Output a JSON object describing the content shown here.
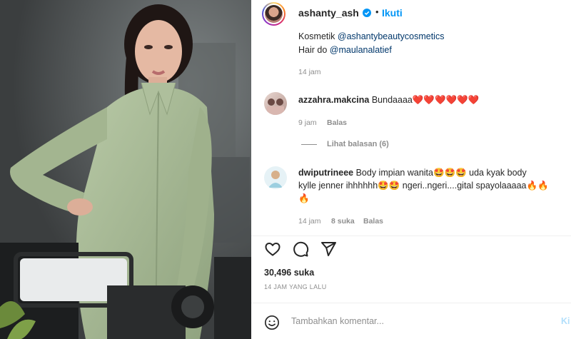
{
  "post": {
    "username": "ashanty_ash",
    "follow_label": "Ikuti",
    "separator": "•",
    "more_icon": "more-options-icon"
  },
  "caption": {
    "line1_prefix": "Kosmetik ",
    "line1_mention": "@ashantybeautycosmetics",
    "line2_prefix": "Hair do ",
    "line2_mention": "@maulanalatief",
    "time": "14 jam"
  },
  "comments": [
    {
      "username": "azzahra.makcina",
      "text": "Bundaaaa❤️❤️❤️❤️❤️❤️",
      "time": "9 jam",
      "reply_label": "Balas",
      "view_replies": "Lihat balasan (6)"
    },
    {
      "username": "dwiputrineee",
      "text_line1": "Body impian wanita🤩🤩🤩 uda kyak body",
      "text_line2": "kylle jenner ihhhhhh🤩🤩 ngeri..ngeri....gital spayolaaaaa🔥🔥",
      "text_line3": "🔥",
      "time": "14 jam",
      "likes": "8 suka",
      "reply_label": "Balas"
    }
  ],
  "engagement": {
    "likes": "30,496 suka",
    "timestamp": "14 JAM YANG LALU"
  },
  "add_comment": {
    "placeholder": "Tambahkan komentar...",
    "post_label": "Ki"
  },
  "colors": {
    "accent": "#0095f6",
    "text": "#262626",
    "muted": "#8e8e8e",
    "mention": "#00376b",
    "jacket": "#a9bb98"
  }
}
